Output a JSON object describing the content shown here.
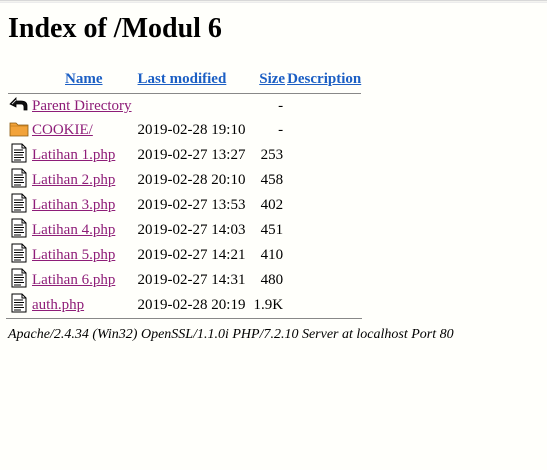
{
  "page": {
    "title": "Index of /Modul 6"
  },
  "columns": {
    "name": "Name",
    "last_modified": "Last modified",
    "size": "Size",
    "description": "Description"
  },
  "entries": [
    {
      "icon": "back-icon",
      "name": "Parent Directory",
      "modified": "",
      "size": "-"
    },
    {
      "icon": "folder-icon",
      "name": "COOKIE/",
      "modified": "2019-02-28 19:10",
      "size": "-"
    },
    {
      "icon": "text-file-icon",
      "name": "Latihan 1.php",
      "modified": "2019-02-27 13:27",
      "size": "253"
    },
    {
      "icon": "text-file-icon",
      "name": "Latihan 2.php",
      "modified": "2019-02-28 20:10",
      "size": "458"
    },
    {
      "icon": "text-file-icon",
      "name": "Latihan 3.php",
      "modified": "2019-02-27 13:53",
      "size": "402"
    },
    {
      "icon": "text-file-icon",
      "name": "Latihan 4.php",
      "modified": "2019-02-27 14:03",
      "size": "451"
    },
    {
      "icon": "text-file-icon",
      "name": "Latihan 5.php",
      "modified": "2019-02-27 14:21",
      "size": "410"
    },
    {
      "icon": "text-file-icon",
      "name": "Latihan 6.php",
      "modified": "2019-02-27 14:31",
      "size": "480"
    },
    {
      "icon": "text-file-icon",
      "name": "auth.php",
      "modified": "2019-02-28 20:19",
      "size": "1.9K"
    }
  ],
  "footer": {
    "signature": "Apache/2.4.34 (Win32) OpenSSL/1.1.0i PHP/7.2.10 Server at localhost Port 80"
  },
  "colors": {
    "header_link": "#1c5fc4",
    "entry_link": "#8e1d78",
    "background": "#fffffb"
  }
}
